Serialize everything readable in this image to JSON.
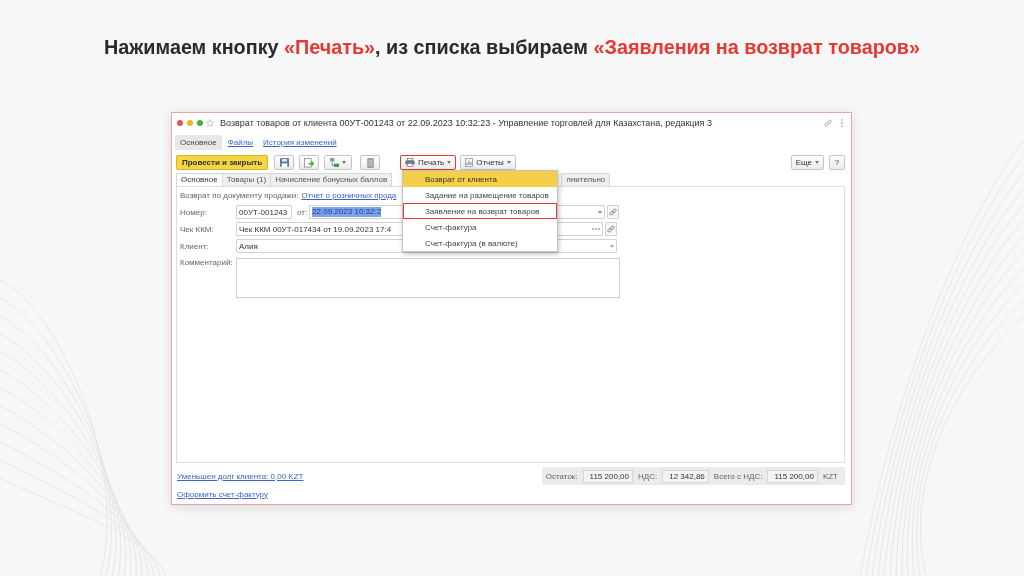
{
  "heading": [
    {
      "text": "Нажимаем кнопку ",
      "highlight": false
    },
    {
      "text": "«Печать»",
      "highlight": true
    },
    {
      "text": ", из списка выбираем ",
      "highlight": false
    },
    {
      "text": "«Заявления на возврат товаров»",
      "highlight": true
    }
  ],
  "window": {
    "title": "Возврат товаров от клиента 00УТ-001243 от 22.09.2023 10:32:23 - Управление торговлей для Казахстана, редакция 3"
  },
  "sections": [
    {
      "label": "Основное",
      "selected": true
    },
    {
      "label": "Файлы",
      "selected": false
    },
    {
      "label": "История изменений",
      "selected": false
    }
  ],
  "toolbar": {
    "post_button": "Провести и закрыть",
    "print_button": {
      "label": "Печать",
      "highlighted": true
    },
    "reports_button": "Отчеты",
    "more_button": "Еще",
    "help_button": "?"
  },
  "form_tabs": [
    {
      "label": "Основное",
      "selected": true
    },
    {
      "label": "Товары (1)",
      "selected": false
    },
    {
      "label": "Начисление бонусных баллов",
      "selected": false
    },
    {
      "label": "лнительно",
      "selected": false
    }
  ],
  "form": {
    "sale_document": {
      "label": "Возврат по документу продажи:",
      "link": "Отчет о розничных прода"
    },
    "number": {
      "label": "Номер:",
      "value": "00УТ-001243"
    },
    "date": {
      "label": "от:",
      "value": "22.09.2023 10:32:2",
      "text_selected": true
    },
    "receipt": {
      "label": "Чек ККМ:",
      "value": "Чек ККМ 00УТ-017434 от 19.09.2023 17:4"
    },
    "client": {
      "label": "Клиент:",
      "value": "Алия"
    },
    "comment": {
      "label": "Комментарий:"
    }
  },
  "print_menu": [
    {
      "label": "Возврат от клиента",
      "selected": true,
      "marked": false
    },
    {
      "label": "Задание на размещение товаров",
      "selected": false,
      "marked": false
    },
    {
      "label": "Заявление на возврат товаров",
      "selected": false,
      "marked": true
    },
    {
      "label": "Счет-фактура",
      "selected": false,
      "marked": false
    },
    {
      "label": "Счет-фактура (в валюте)",
      "selected": false,
      "marked": false
    }
  ],
  "footer": {
    "links": [
      "Уменьшен долг клиента: 0,00 KZT",
      "Оформить счет-фактуру"
    ],
    "totals": [
      {
        "label": "Остаток:",
        "value": "115 200,00"
      },
      {
        "label": "НДС:",
        "value": "12 342,86"
      },
      {
        "label": "Всего с НДС:",
        "value": "115 200,00"
      }
    ],
    "currency": "KZT"
  }
}
